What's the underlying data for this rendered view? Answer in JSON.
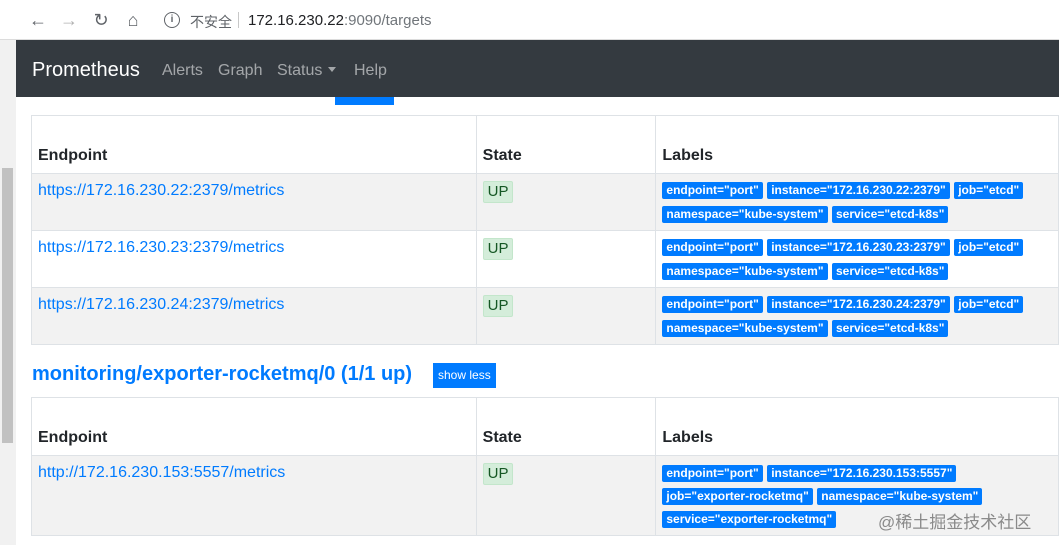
{
  "browser": {
    "back_icon": "arrow-left-icon",
    "forward_icon": "arrow-right-icon",
    "reload_icon": "reload-icon",
    "home_icon": "home-icon",
    "security_icon": "info-icon",
    "insecure_label": "不安全",
    "url_host": "172.16.230.22",
    "url_rest": ":9090/targets"
  },
  "navbar": {
    "brand": "Prometheus",
    "links": [
      "Alerts",
      "Graph",
      "Status",
      "Help"
    ],
    "bg_color": "#343a40"
  },
  "headers": {
    "endpoint": "Endpoint",
    "state": "State",
    "labels": "Labels"
  },
  "etcd_rows": [
    {
      "endpoint": "https://172.16.230.22:2379/metrics",
      "state": "UP",
      "labels": [
        "endpoint=\"port\"",
        "instance=\"172.16.230.22:2379\"",
        "job=\"etcd\"",
        "namespace=\"kube-system\"",
        "service=\"etcd-k8s\""
      ]
    },
    {
      "endpoint": "https://172.16.230.23:2379/metrics",
      "state": "UP",
      "labels": [
        "endpoint=\"port\"",
        "instance=\"172.16.230.23:2379\"",
        "job=\"etcd\"",
        "namespace=\"kube-system\"",
        "service=\"etcd-k8s\""
      ]
    },
    {
      "endpoint": "https://172.16.230.24:2379/metrics",
      "state": "UP",
      "labels": [
        "endpoint=\"port\"",
        "instance=\"172.16.230.24:2379\"",
        "job=\"etcd\"",
        "namespace=\"kube-system\"",
        "service=\"etcd-k8s\""
      ]
    }
  ],
  "rocketmq": {
    "title": "monitoring/exporter-rocketmq/0 (1/1 up)",
    "toggle": "show less",
    "rows": [
      {
        "endpoint": "http://172.16.230.153:5557/metrics",
        "state": "UP",
        "labels": [
          "endpoint=\"port\"",
          "instance=\"172.16.230.153:5557\"",
          "job=\"exporter-rocketmq\"",
          "namespace=\"kube-system\"",
          "service=\"exporter-rocketmq\""
        ]
      }
    ]
  },
  "watermark": "@稀土掘金技术社区",
  "colors": {
    "link": "#007bff",
    "label_bg": "#007bff",
    "up_bg": "#d4edda",
    "up_text": "#155724"
  }
}
